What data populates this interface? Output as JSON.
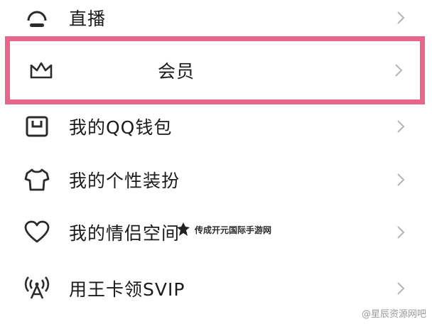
{
  "menu": {
    "items": [
      {
        "label": "直播",
        "icon": "live-icon"
      },
      {
        "label": "会员",
        "icon": "crown-icon",
        "highlighted": true
      },
      {
        "label": "我的QQ钱包",
        "icon": "wallet-icon"
      },
      {
        "label": "我的个性装扮",
        "icon": "tshirt-icon"
      },
      {
        "label": "我的情侣空间",
        "icon": "heart-icon"
      },
      {
        "label": "用王卡领SVIP",
        "icon": "signal-tower-icon"
      }
    ]
  },
  "watermarks": {
    "center_text": "传成开元国际手游网",
    "corner_text": "@星辰资源网吧"
  },
  "colors": {
    "highlight_border": "#e8668c",
    "text": "#1a1a1a",
    "icon": "#2b2b2b",
    "chevron": "#b5b5b5"
  }
}
